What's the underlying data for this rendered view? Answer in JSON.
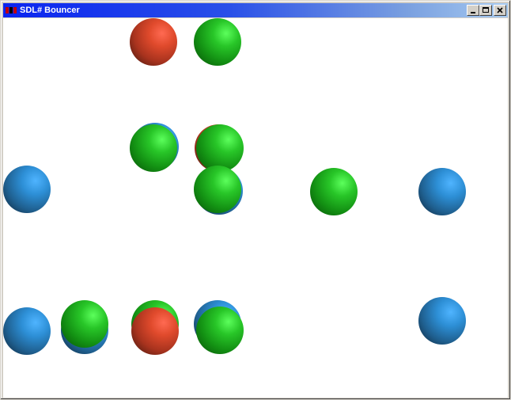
{
  "window": {
    "title": "SDL# Bouncer",
    "icon": "sdl-app-icon",
    "controls": [
      "minimize-icon",
      "maximize-icon",
      "close-icon"
    ]
  },
  "canvas": {
    "background": "#ffffff",
    "ball_colors": {
      "green": "#1fb01f",
      "red": "#d2472b",
      "blue": "#2a86c8"
    }
  }
}
